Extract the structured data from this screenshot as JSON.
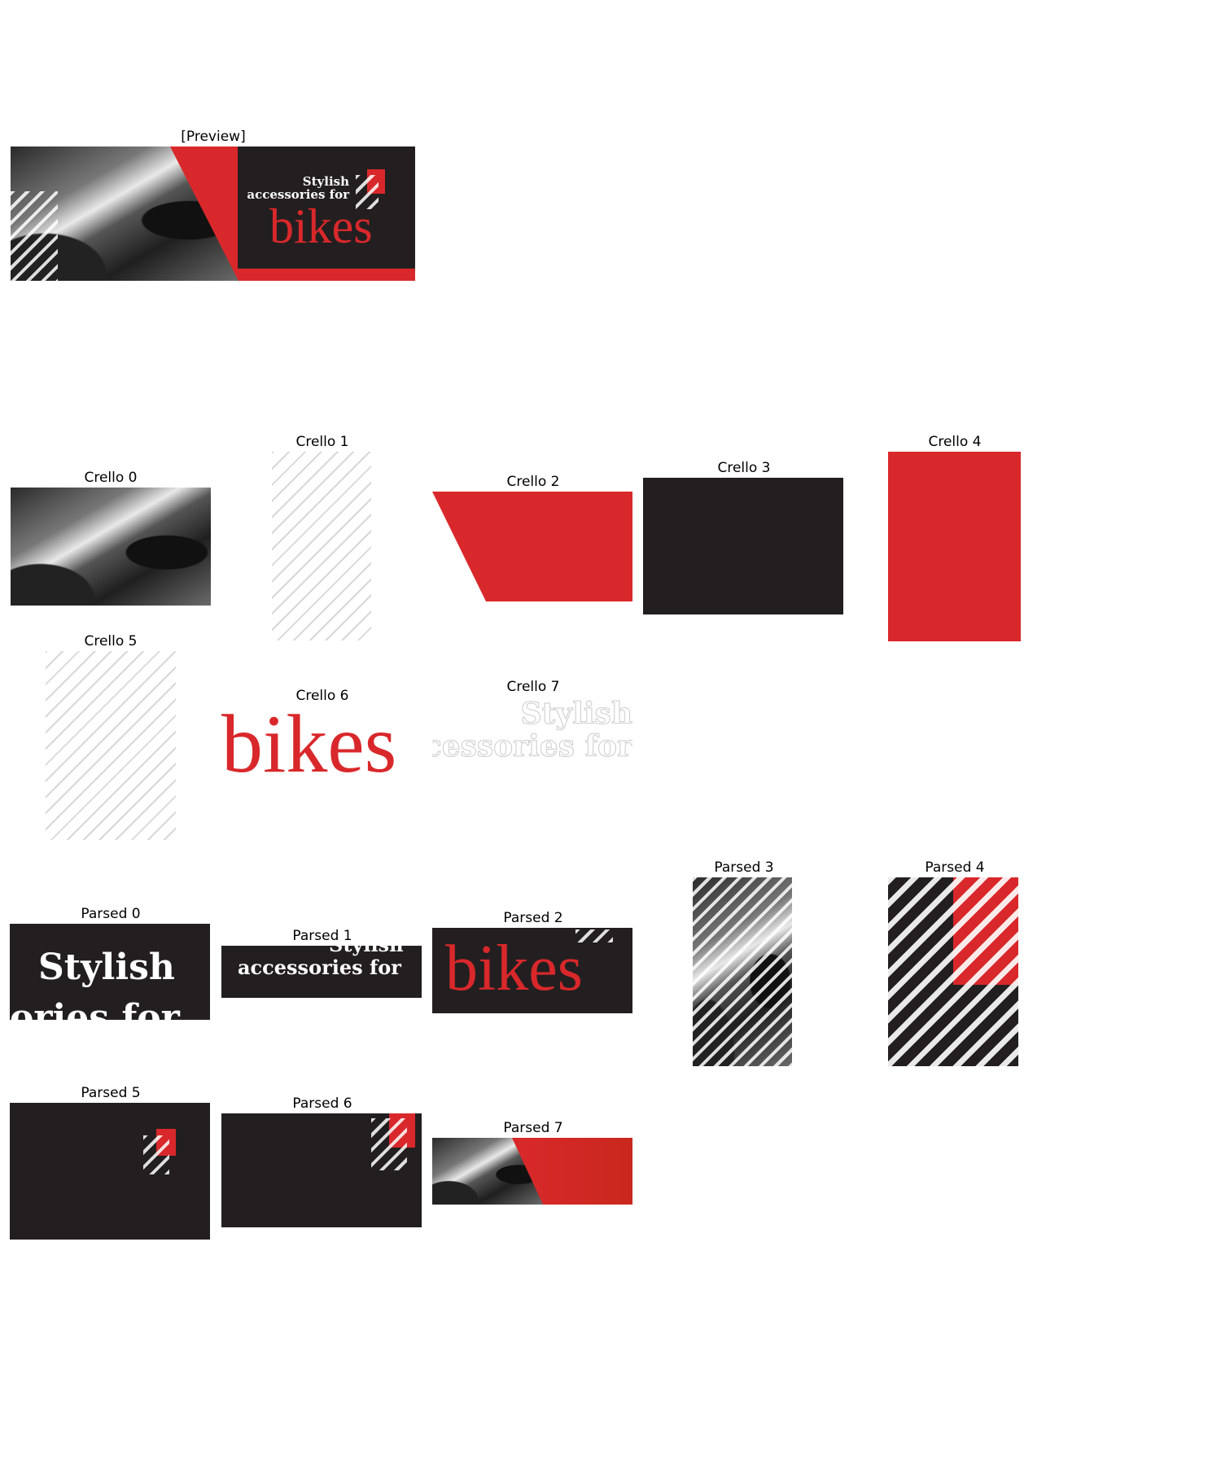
{
  "captions": {
    "preview": "[Preview]",
    "crello": [
      "Crello 0",
      "Crello 1",
      "Crello 2",
      "Crello 3",
      "Crello 4",
      "Crello 5",
      "Crello 6",
      "Crello 7"
    ],
    "parsed": [
      "Parsed 0",
      "Parsed 1",
      "Parsed 2",
      "Parsed 3",
      "Parsed 4",
      "Parsed 5",
      "Parsed 6",
      "Parsed 7"
    ]
  },
  "design": {
    "line1": "Stylish",
    "line2": "accessories for",
    "headline": "bikes"
  },
  "crops": {
    "parsed0_line1": "Stylish",
    "parsed0_line2": "ories for",
    "parsed1_line1": "Stylish",
    "parsed1_line2": "accessories for",
    "crello7_line1": "Stylish",
    "crello7_line2": "cessories for"
  },
  "colors": {
    "red": "#d9282b",
    "dark": "#231f20",
    "white": "#ffffff"
  }
}
